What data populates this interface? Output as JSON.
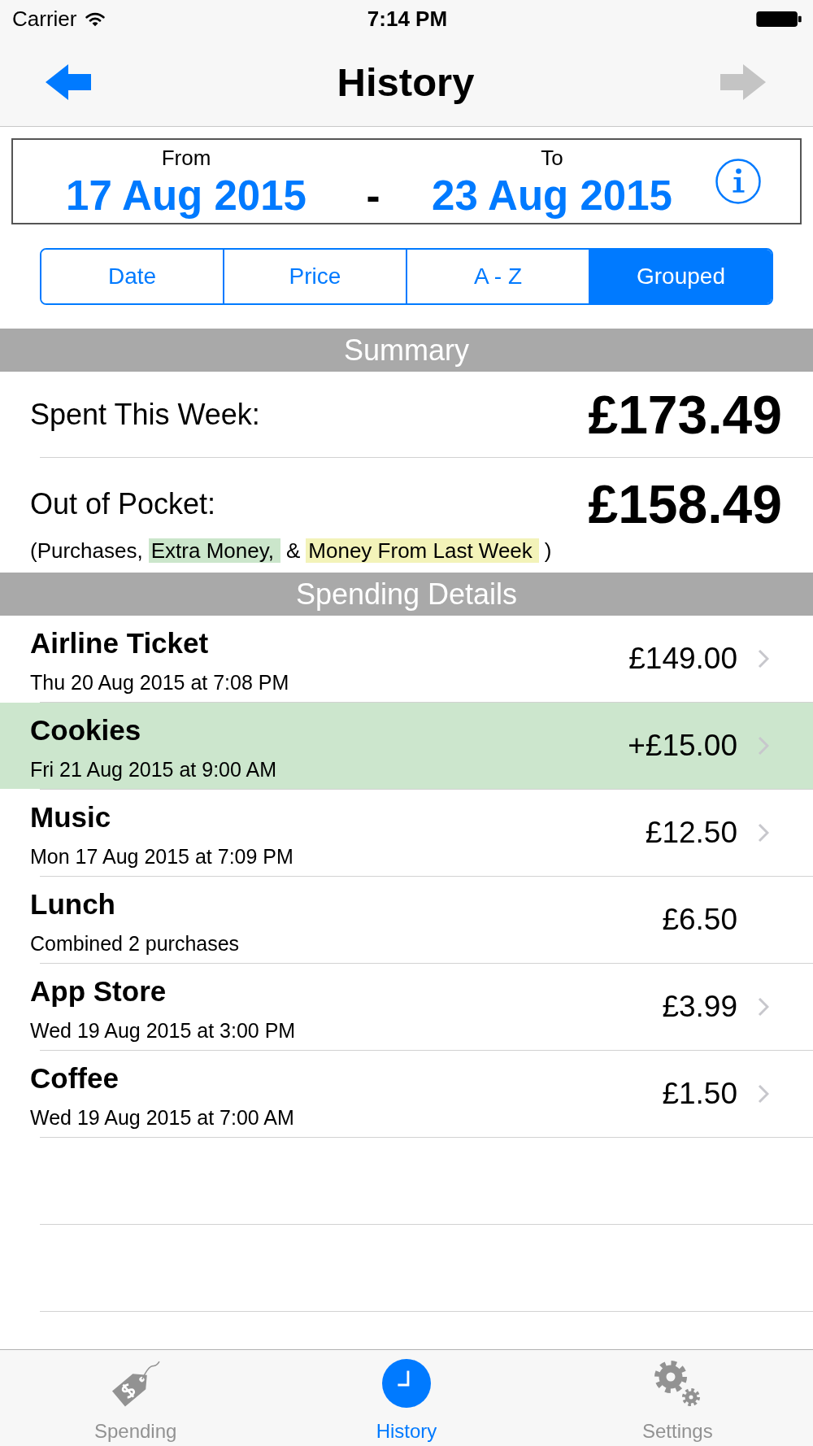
{
  "status_bar": {
    "carrier": "Carrier",
    "time": "7:14 PM"
  },
  "nav_bar": {
    "title": "History",
    "back": {
      "enabled": true
    },
    "forward": {
      "enabled": false
    }
  },
  "date_range": {
    "from_label": "From",
    "from": "17 Aug 2015",
    "separator": "-",
    "to_label": "To",
    "to": "23 Aug 2015"
  },
  "sort_options": [
    {
      "label": "Date",
      "selected": false
    },
    {
      "label": "Price",
      "selected": false
    },
    {
      "label": "A - Z",
      "selected": false
    },
    {
      "label": "Grouped",
      "selected": true
    }
  ],
  "summary": {
    "header": "Summary",
    "rows": [
      {
        "label": "Spent This Week:",
        "amount": "£173.49"
      },
      {
        "label": "Out of Pocket:",
        "amount": "£158.49",
        "legend": [
          {
            "text": "(Purchases,"
          },
          {
            "text": "Extra Money,",
            "color": "#cbe6cb"
          },
          {
            "text": "&"
          },
          {
            "text": "Money From Last Week",
            "color": "#f3f3b9"
          },
          {
            "text": ")"
          }
        ]
      }
    ]
  },
  "spending_details": {
    "header": "Spending Details",
    "rows": [
      {
        "kind": "purchase",
        "title": "Airline Ticket",
        "subtitle": "Thu 20 Aug 2015 at 7:08 PM",
        "amount": "£149.00"
      },
      {
        "kind": "extra",
        "title": "Cookies",
        "subtitle": "Fri 21 Aug 2015 at 9:00 AM",
        "amount": "+£15.00"
      },
      {
        "kind": "purchase",
        "title": "Music",
        "subtitle": "Mon 17 Aug 2015 at 7:09 PM",
        "amount": "£12.50"
      },
      {
        "kind": "combined",
        "title": "Lunch",
        "subtitle": "Combined 2 purchases",
        "amount": "£6.50"
      },
      {
        "kind": "purchase",
        "title": "App Store",
        "subtitle": "Wed 19 Aug 2015 at 3:00 PM",
        "amount": "£3.99"
      },
      {
        "kind": "purchase",
        "title": "Coffee",
        "subtitle": "Wed 19 Aug 2015 at 7:00 AM",
        "amount": "£1.50"
      }
    ]
  },
  "tab_bar": [
    {
      "label": "Spending",
      "selected": false
    },
    {
      "label": "History",
      "selected": true
    },
    {
      "label": "Settings",
      "selected": false
    }
  ]
}
